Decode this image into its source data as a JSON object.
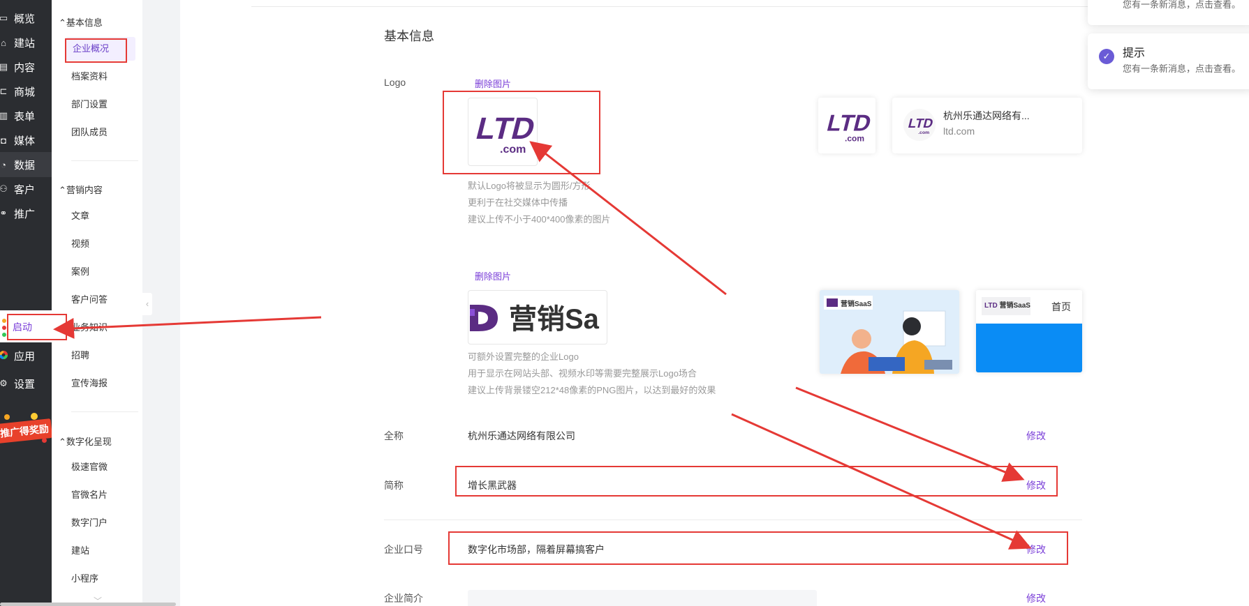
{
  "nav": {
    "items": [
      {
        "label": "概览",
        "icon": "dashboard-icon"
      },
      {
        "label": "建站",
        "icon": "home-icon"
      },
      {
        "label": "内容",
        "icon": "document-icon"
      },
      {
        "label": "商城",
        "icon": "cart-icon"
      },
      {
        "label": "表单",
        "icon": "form-icon"
      },
      {
        "label": "媒体",
        "icon": "camera-icon"
      },
      {
        "label": "数据",
        "icon": "chart-icon"
      },
      {
        "label": "客户",
        "icon": "user-icon"
      },
      {
        "label": "推广",
        "icon": "link-icon"
      }
    ],
    "active": "数据",
    "start_label": "启动",
    "apps_label": "应用",
    "settings_label": "设置",
    "promo_label": "推广得奖励"
  },
  "submenu": {
    "groups": [
      {
        "title": "基本信息",
        "items": [
          "企业概况",
          "档案资料",
          "部门设置",
          "团队成员"
        ]
      },
      {
        "title": "营销内容",
        "items": [
          "文章",
          "视频",
          "案例",
          "客户问答",
          "业务知识",
          "招聘",
          "宣传海报"
        ]
      },
      {
        "title": "数字化呈现",
        "items": [
          "极速官微",
          "官微名片",
          "数字门户",
          "建站",
          "小程序"
        ]
      }
    ],
    "active_item": "企业概况"
  },
  "main": {
    "section_title": "基本信息",
    "logo": {
      "label": "Logo",
      "delete_label": "删除图片",
      "logo_text": "LTD",
      "logo_sub": ".com",
      "hints": [
        "默认Logo将被显示为圆形/方形",
        "更利于在社交媒体中传播",
        "建议上传不小于400*400像素的图片"
      ]
    },
    "full_logo": {
      "delete_label": "删除图片",
      "logo_text": "营销Sa",
      "hints": [
        "可额外设置完整的企业Logo",
        "用于显示在网站头部、视频水印等需要完整展示Logo场合",
        "建议上传背景镂空212*48像素的PNG图片，以达到最好的效果"
      ]
    },
    "preview_card": {
      "name": "杭州乐通达网络有...",
      "domain": "ltd.com"
    },
    "preview_site": {
      "brand": "营销SaaS",
      "home_label": "首页"
    },
    "fields": [
      {
        "label": "全称",
        "value": "杭州乐通达网络有限公司",
        "edit": "修改"
      },
      {
        "label": "简称",
        "value": "增长黑武器",
        "edit": "修改"
      },
      {
        "label": "企业口号",
        "value": "数字化市场部，隔着屏幕搞客户",
        "edit": "修改"
      },
      {
        "label": "企业简介",
        "value": "",
        "edit": "修改"
      }
    ]
  },
  "toasts": [
    {
      "title": "",
      "message": "您有一条新消息，点击查看。"
    },
    {
      "title": "提示",
      "message": "您有一条新消息，点击查看。"
    }
  ],
  "colors": {
    "accent": "#7a3ed8",
    "nav_bg": "#2b2d31",
    "annotation": "#e53935",
    "brand_purple": "#5b2c83"
  }
}
